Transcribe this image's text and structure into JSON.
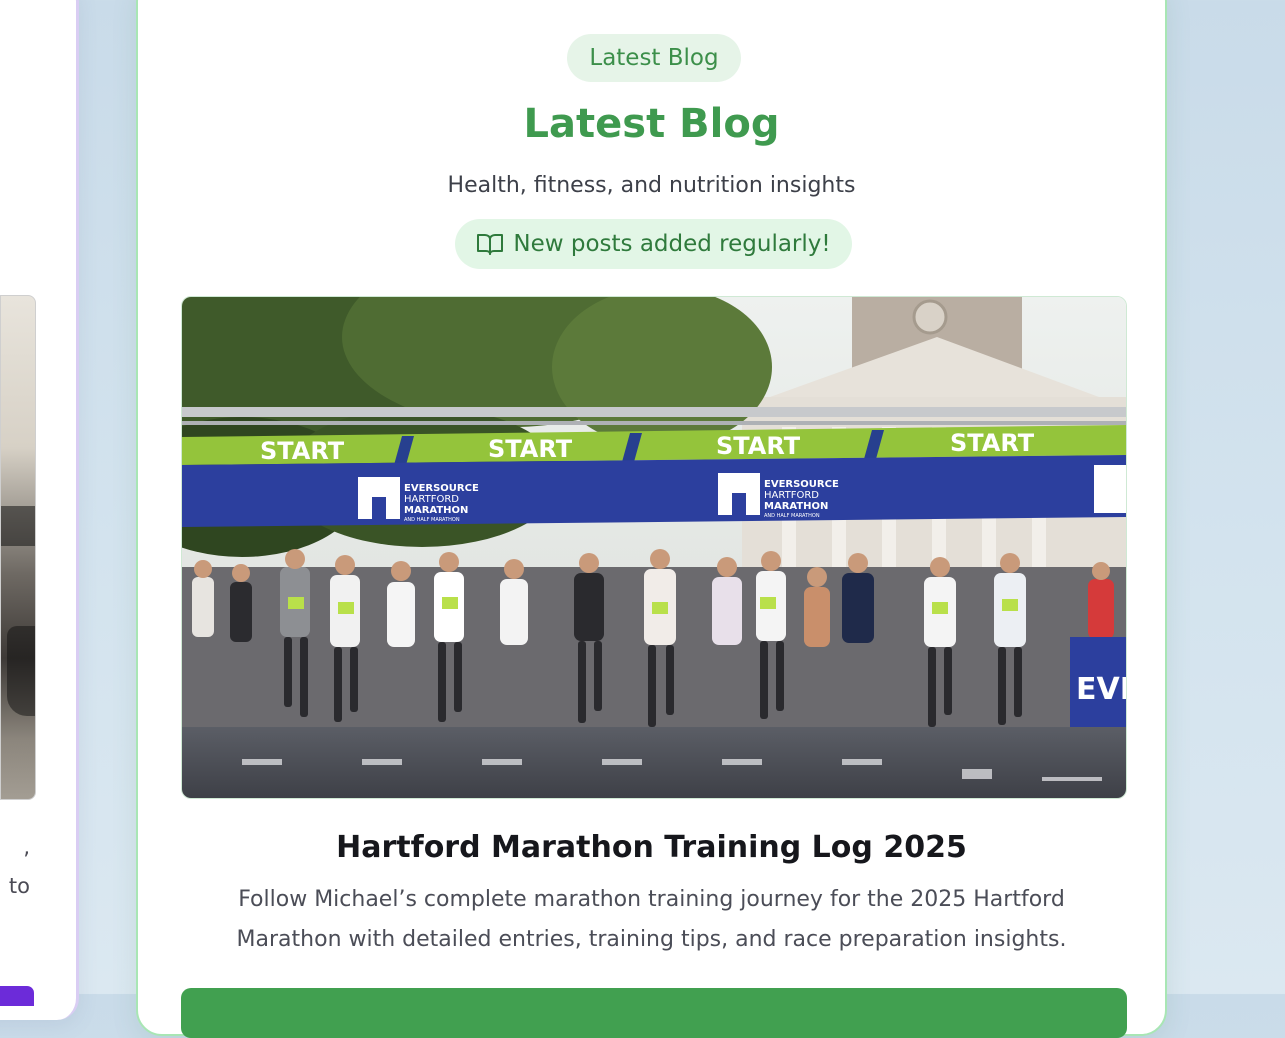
{
  "left_card": {
    "text_fragment_lines": [
      ",",
      "to"
    ],
    "button_color": "#6c2bd9"
  },
  "blog_section": {
    "eyebrow_label": "Latest Blog",
    "title": "Latest Blog",
    "subtitle": "Health, fitness, and nutrition insights",
    "notice": {
      "icon": "open-book-icon",
      "text": "New posts added regularly!"
    },
    "featured_post": {
      "image_banner_words": [
        "START",
        "START",
        "START",
        "START"
      ],
      "image_sponsor_text": [
        "EVERSOURCE",
        "HARTFORD",
        "MARATHON",
        "AND HALF MARATHON"
      ],
      "image_sign_fragment": "EVE",
      "title": "Hartford Marathon Training Log 2025",
      "description": "Follow Michael’s complete marathon training journey for the 2025 Hartford Marathon with detailed entries, training tips, and race preparation insights."
    }
  },
  "colors": {
    "accent_green": "#3f9a4f",
    "card_border": "#a8e6b4",
    "pill_background": "#e2f6e6",
    "page_background": "#c9dbe9"
  }
}
